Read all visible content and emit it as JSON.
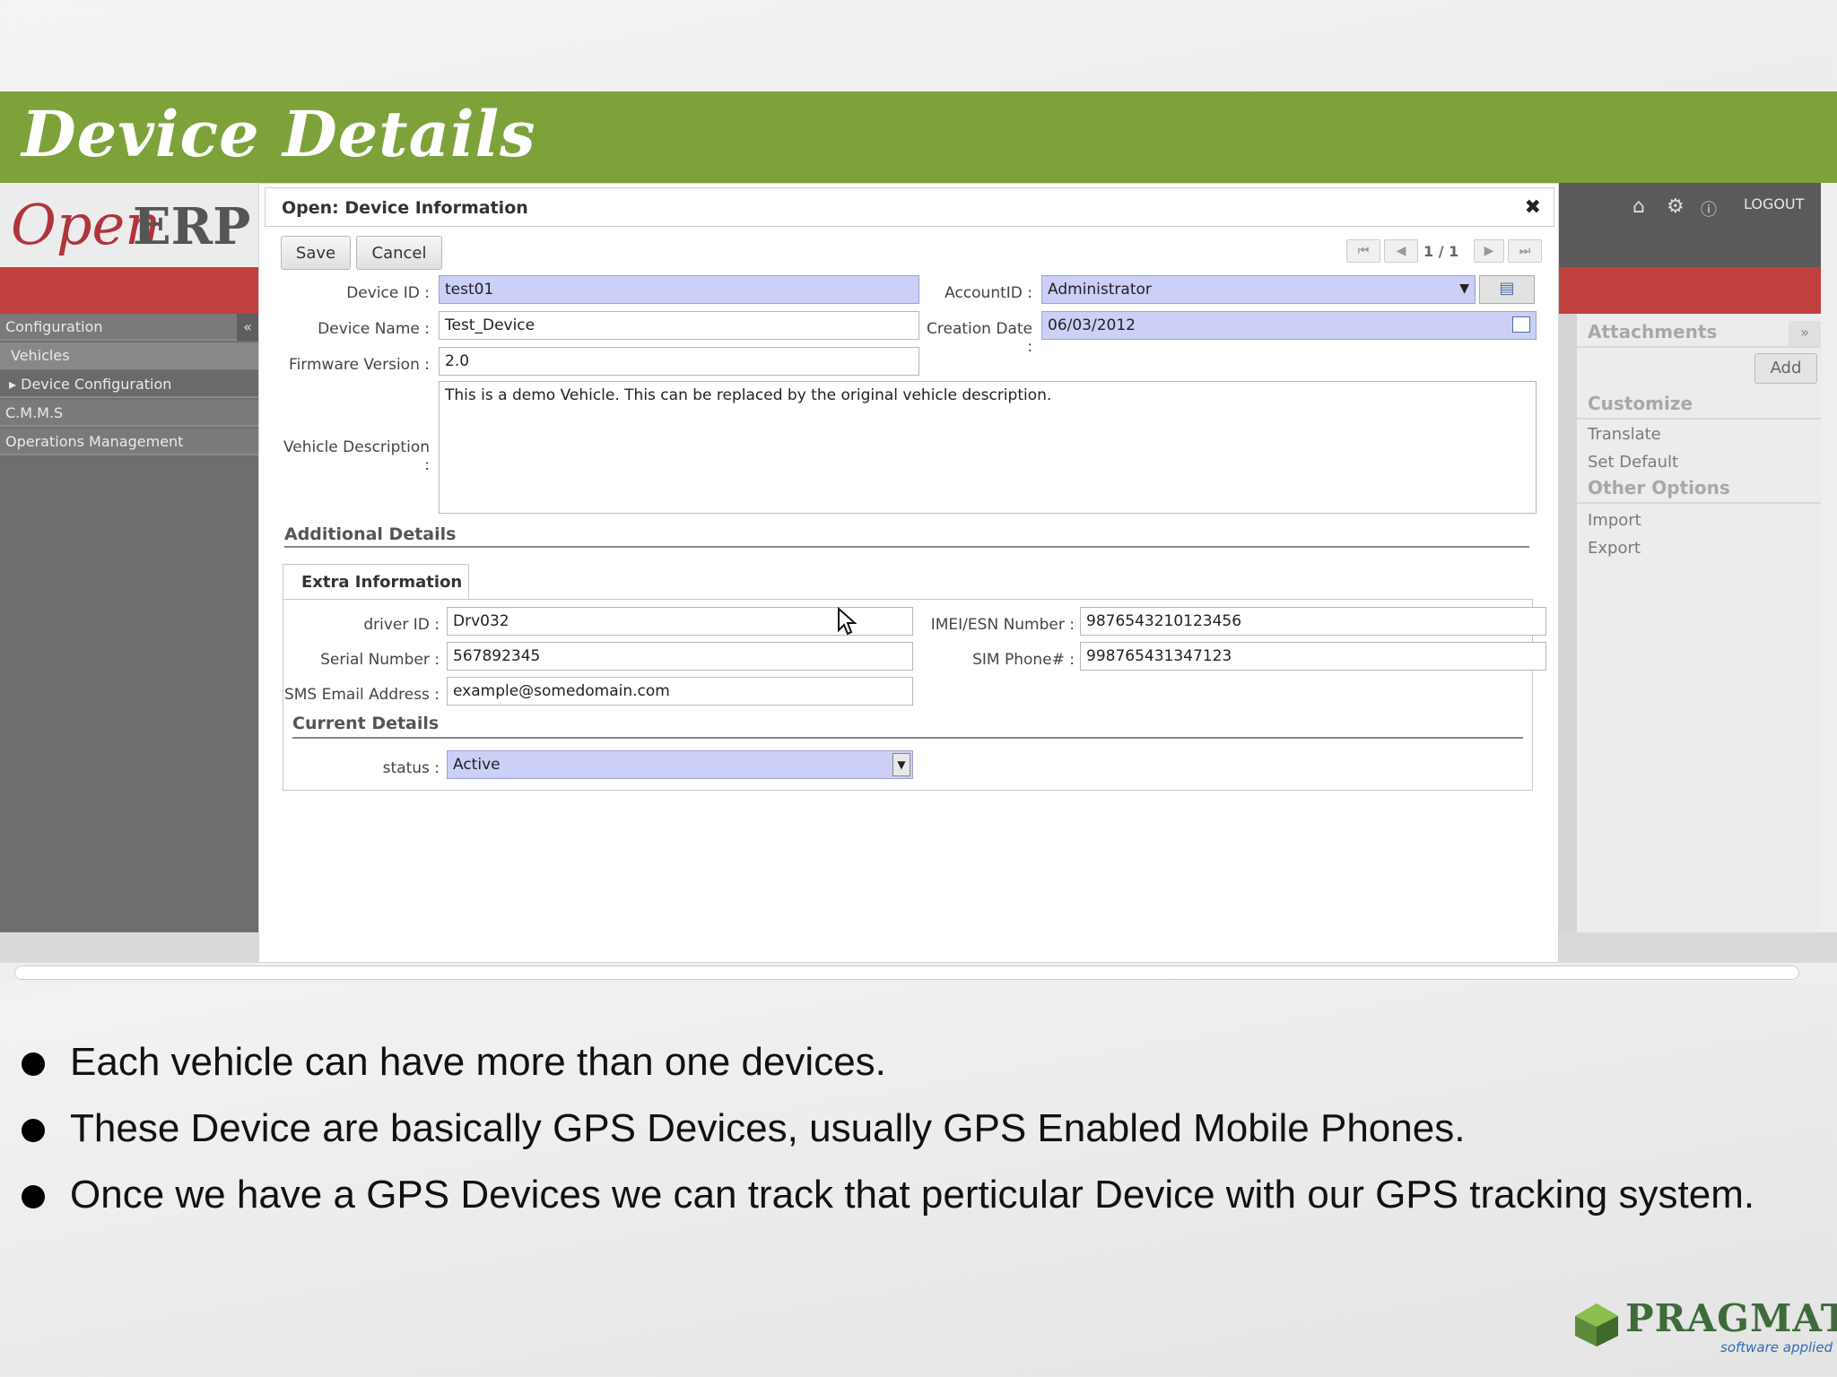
{
  "slide": {
    "title": "Device Details",
    "bullets": [
      "Each vehicle can have more than one devices.",
      "These Device are basically GPS Devices, usually GPS Enabled Mobile Phones.",
      "Once we have a GPS Devices we can track that perticular Device with our GPS tracking system."
    ],
    "brand_name": "PRAGMATIC",
    "brand_tagline": "software applied",
    "accent_color": "#7da23a"
  },
  "app": {
    "logo_open": "Open",
    "logo_erp": "ERP",
    "logout_label": "LOGOUT",
    "collapse_label": "«",
    "menu": [
      {
        "label": "Configuration"
      },
      {
        "label": "Vehicles"
      },
      {
        "label": "▸ Device Configuration"
      },
      {
        "label": "C.M.M.S"
      },
      {
        "label": "Operations Management"
      }
    ],
    "sidebar": {
      "attachments_title": "Attachments",
      "expand_label": "»",
      "add_label": "Add",
      "customize_title": "Customize",
      "translate_label": "Translate",
      "set_default_label": "Set Default",
      "other_options_title": "Other Options",
      "import_label": "Import",
      "export_label": "Export"
    }
  },
  "dialog": {
    "title": "Open: Device Information",
    "close_label": "✖",
    "save_label": "Save",
    "cancel_label": "Cancel",
    "pager_text": "1 / 1",
    "pager_first": "⏮",
    "pager_prev": "◀",
    "pager_next": "▶",
    "pager_last": "⏭",
    "fields": {
      "device_id": {
        "label": "Device ID :",
        "value": "test01"
      },
      "account_id": {
        "label": "AccountID :",
        "value": "Administrator"
      },
      "device_name": {
        "label": "Device Name :",
        "value": "Test_Device"
      },
      "creation_date": {
        "label": "Creation Date :",
        "value": "06/03/2012"
      },
      "firmware_version": {
        "label": "Firmware Version :",
        "value": "2.0"
      },
      "vehicle_description": {
        "label": "Vehicle Description :",
        "value": "This is a demo Vehicle. This can be replaced by the original vehicle description."
      }
    },
    "additional_details_title": "Additional Details",
    "tab_label": "Extra Information",
    "extra": {
      "driver_id": {
        "label": "driver ID :",
        "value": "Drv032"
      },
      "imei": {
        "label": "IMEI/ESN Number :",
        "value": "9876543210123456"
      },
      "serial_number": {
        "label": "Serial Number :",
        "value": "567892345"
      },
      "sim_phone": {
        "label": "SIM Phone# :",
        "value": "998765431347123"
      },
      "sms_email": {
        "label": "SMS Email Address :",
        "value": "example@somedomain.com"
      }
    },
    "current_details_title": "Current Details",
    "status": {
      "label": "status :",
      "value": "Active"
    },
    "required_field_color": "#cdd0f6"
  }
}
